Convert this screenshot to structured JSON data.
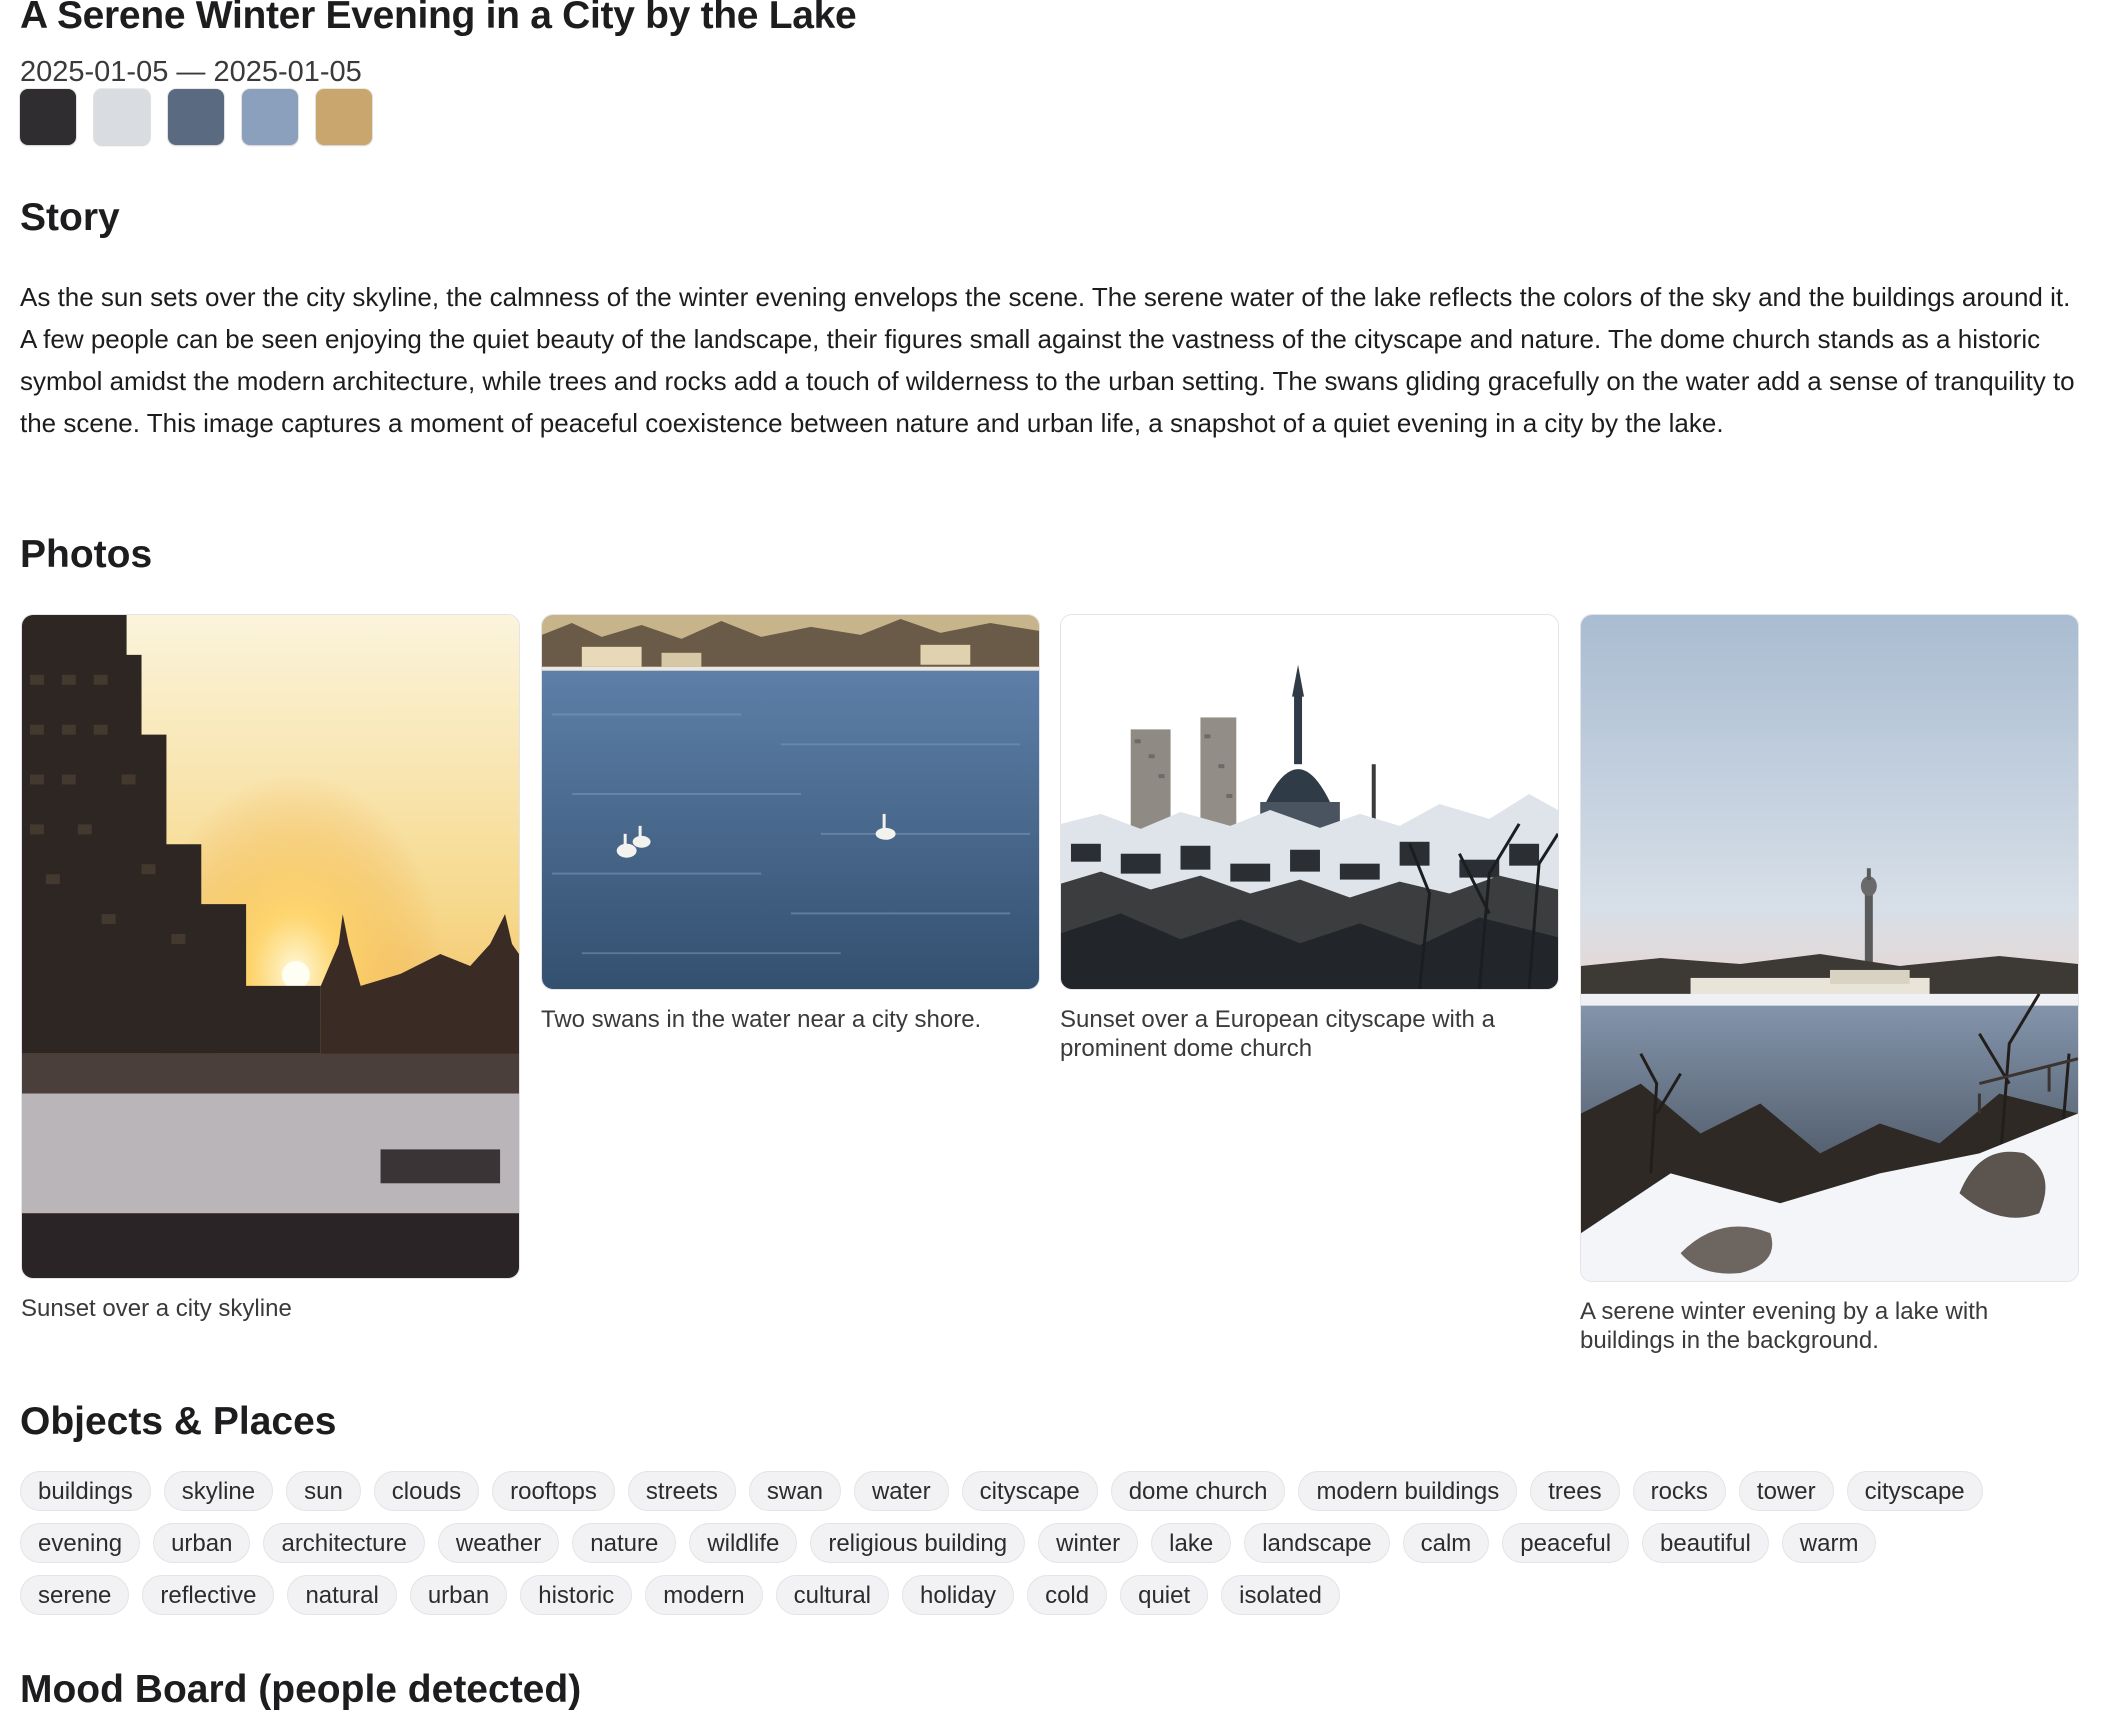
{
  "header": {
    "title": "A Serene Winter Evening in a City by the Lake",
    "date_range": "2025-01-05 — 2025-01-05"
  },
  "palette": [
    "#2f2d30",
    "#d9dce0",
    "#5a6a80",
    "#8aa0bc",
    "#c9a66e"
  ],
  "story": {
    "heading": "Story",
    "text": "As the sun sets over the city skyline, the calmness of the winter evening envelops the scene. The serene water of the lake reflects the colors of the sky and the buildings around it. A few people can be seen enjoying the quiet beauty of the landscape, their figures small against the vastness of the cityscape and nature. The dome church stands as a historic symbol amidst the modern architecture, while trees and rocks add a touch of wilderness to the urban setting. The swans gliding gracefully on the water add a sense of tranquility to the scene. This image captures a moment of peaceful coexistence between nature and urban life, a snapshot of a quiet evening in a city by the lake."
  },
  "photos": {
    "heading": "Photos",
    "items": [
      {
        "caption": "Sunset over a city skyline"
      },
      {
        "caption": "Two swans in the water near a city shore."
      },
      {
        "caption": "Sunset over a European cityscape with a prominent dome church"
      },
      {
        "caption": "A serene winter evening by a lake with buildings in the background."
      }
    ]
  },
  "objects": {
    "heading": "Objects & Places",
    "rows": [
      [
        "buildings",
        "skyline",
        "sun",
        "clouds",
        "rooftops",
        "streets",
        "swan",
        "water",
        "cityscape",
        "dome church",
        "modern buildings",
        "trees",
        "rocks",
        "tower",
        "cityscape"
      ],
      [
        "evening",
        "urban",
        "architecture",
        "weather",
        "nature",
        "wildlife",
        "religious building",
        "winter",
        "lake",
        "landscape",
        "calm",
        "peaceful",
        "beautiful",
        "warm"
      ],
      [
        "serene",
        "reflective",
        "natural",
        "urban",
        "historic",
        "modern",
        "cultural",
        "holiday",
        "cold",
        "quiet",
        "isolated"
      ]
    ]
  },
  "mood_board": {
    "heading": "Mood Board (people detected)"
  }
}
